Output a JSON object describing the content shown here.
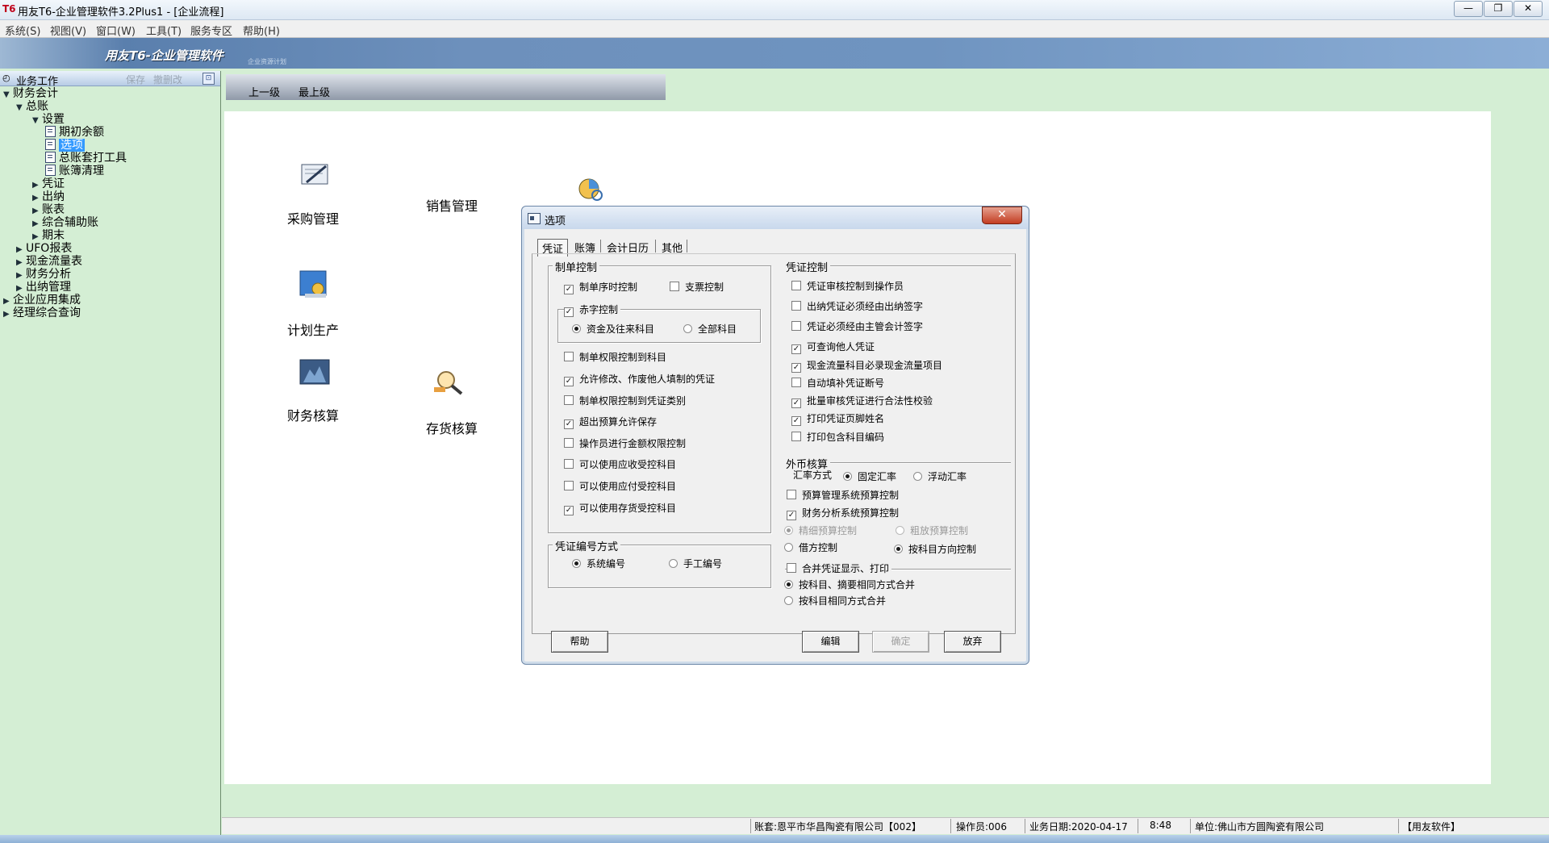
{
  "window": {
    "logo": "T6",
    "title": "用友T6-企业管理软件3.2Plus1 - [企业流程]",
    "minimize": "—",
    "restore": "❐",
    "close": "✕"
  },
  "menubar": [
    "系统(S)",
    "视图(V)",
    "窗口(W)",
    "工具(T)",
    "服务专区",
    "帮助(H)"
  ],
  "banner": {
    "brand": "用友T6-企业管理软件",
    "sub": "企业资源计划"
  },
  "left_panel": {
    "title": "业务工作",
    "save": "保存",
    "delete": "撤删改",
    "pin": "⊡",
    "tree": [
      {
        "label": "财务会计",
        "toggle": "▼"
      },
      {
        "label": "总账",
        "toggle": "▼"
      },
      {
        "label": "设置",
        "toggle": "▼"
      },
      {
        "label": "期初余额"
      },
      {
        "label": "选项"
      },
      {
        "label": "总账套打工具"
      },
      {
        "label": "账簿清理"
      },
      {
        "label": "凭证",
        "toggle": "▶"
      },
      {
        "label": "出纳",
        "toggle": "▶"
      },
      {
        "label": "账表",
        "toggle": "▶"
      },
      {
        "label": "综合辅助账",
        "toggle": "▶"
      },
      {
        "label": "期末",
        "toggle": "▶"
      },
      {
        "label": "UFO报表",
        "toggle": "▶"
      },
      {
        "label": "现金流量表",
        "toggle": "▶"
      },
      {
        "label": "财务分析",
        "toggle": "▶"
      },
      {
        "label": "出纳管理",
        "toggle": "▶"
      },
      {
        "label": "企业应用集成",
        "toggle": "▶"
      },
      {
        "label": "经理综合查询",
        "toggle": "▶"
      }
    ]
  },
  "nav": {
    "up": "上一级",
    "top": "最上级"
  },
  "modules": [
    "采购管理",
    "销售管理",
    "计划生产",
    "财务核算",
    "存货核算"
  ],
  "status_bar": {
    "account": "账套:恩平市华昌陶瓷有限公司【002】",
    "operator": "操作员:006",
    "date": "业务日期:2020-04-17",
    "time": "8:48",
    "unit": "单位:佛山市方圆陶瓷有限公司",
    "vendor": "【用友软件】"
  },
  "dialog": {
    "title": "选项",
    "close": "✕",
    "tabs": [
      "凭证",
      "账簿",
      "会计日历",
      "其他"
    ],
    "make_control": {
      "title": "制单控制",
      "time_order": "制单序时控制",
      "cheque": "支票控制",
      "red_title": "赤字控制",
      "red_opt1": "资金及往来科目",
      "red_opt2": "全部科目",
      "items": [
        "制单权限控制到科目",
        "允许修改、作废他人填制的凭证",
        "制单权限控制到凭证类别",
        "超出预算允许保存",
        "操作员进行金额权限控制",
        "可以使用应收受控科目",
        "可以使用应付受控科目",
        "可以使用存货受控科目"
      ]
    },
    "numbering": {
      "title": "凭证编号方式",
      "system": "系统编号",
      "manual": "手工编号"
    },
    "voucher_control": {
      "title": "凭证控制",
      "items": [
        "凭证审核控制到操作员",
        "出纳凭证必须经由出纳签字",
        "凭证必须经由主管会计签字",
        "可查询他人凭证",
        "现金流量科目必录现金流量项目",
        "自动填补凭证断号",
        "批量审核凭证进行合法性校验",
        "打印凭证页脚姓名",
        "打印包含科目编码"
      ]
    },
    "foreign": {
      "title": "外币核算",
      "rate_label": "汇率方式",
      "fixed": "固定汇率",
      "floating": "浮动汇率"
    },
    "budget_mgmt": "预算管理系统预算控制",
    "budget_fin": "财务分析系统预算控制",
    "budget_fine": "精细预算控制",
    "budget_rough": "粗放预算控制",
    "budget_debit": "借方控制",
    "budget_dir": "按科目方向控制",
    "merge": {
      "title": "合并凭证显示、打印",
      "opt1": "按科目、摘要相同方式合并",
      "opt2": "按科目相同方式合并"
    },
    "buttons": {
      "help": "帮助",
      "edit": "编辑",
      "ok": "确定",
      "cancel": "放弃"
    }
  }
}
